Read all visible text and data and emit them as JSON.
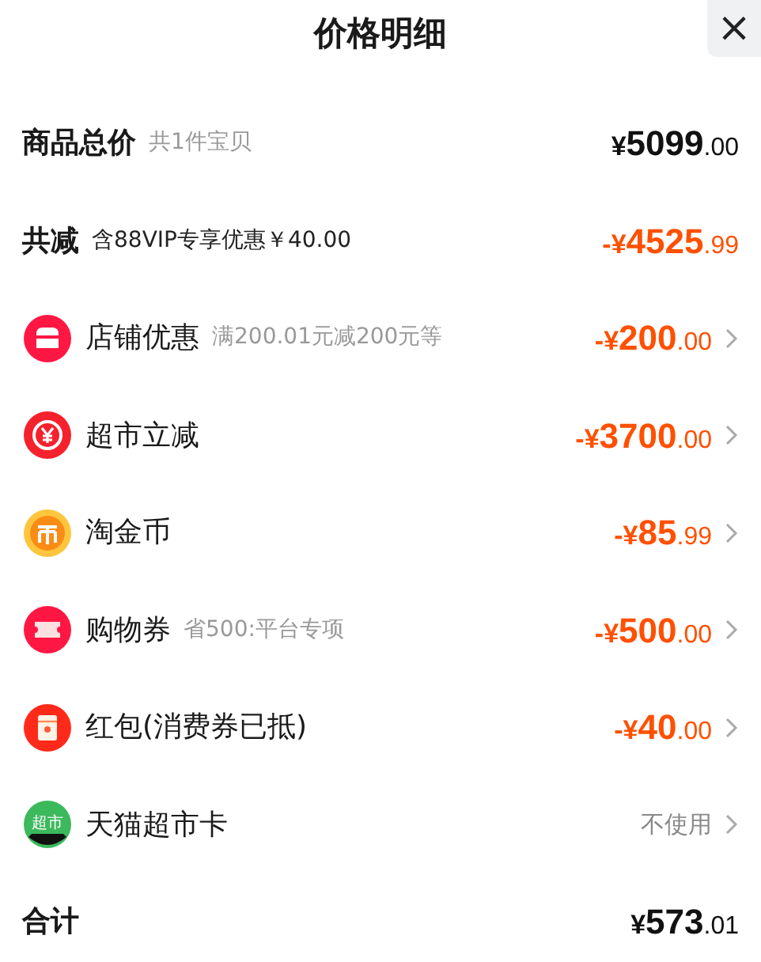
{
  "title": "价格明细",
  "close": "×",
  "rows": [
    {
      "kind": "summary",
      "label": "商品总价",
      "note": "共1件宝贝",
      "amount": {
        "prefix": "¥",
        "integer": "5099",
        "decimal": ".00",
        "negative": false
      },
      "arrow": false
    },
    {
      "kind": "reduction",
      "label": "共减",
      "note": "含88VIP专享优惠￥40.00",
      "amount": {
        "prefix": "-¥",
        "integer": "4525",
        "decimal": ".99",
        "negative": true
      },
      "arrow": false
    },
    {
      "kind": "item",
      "label": "店铺优惠",
      "note": "满200.01元减200元等",
      "amount": {
        "prefix": "-¥",
        "integer": "200",
        "decimal": ".00",
        "negative": true
      },
      "arrow": true
    },
    {
      "kind": "item",
      "label": "超市立减",
      "amount": {
        "prefix": "-¥",
        "integer": "3700",
        "decimal": ".00",
        "negative": true
      },
      "arrow": true
    },
    {
      "kind": "item",
      "label": "淘金币",
      "amount": {
        "prefix": "-¥",
        "integer": "85",
        "decimal": ".99",
        "negative": true
      },
      "arrow": true
    },
    {
      "kind": "item",
      "label": "购物券",
      "note": "省500:平台专项",
      "amount": {
        "prefix": "-¥",
        "integer": "500",
        "decimal": ".00",
        "negative": true
      },
      "arrow": true
    },
    {
      "kind": "item",
      "label": "红包(消费券已抵)",
      "amount": {
        "prefix": "-¥",
        "integer": "40",
        "decimal": ".00",
        "negative": true
      },
      "arrow": true
    },
    {
      "kind": "item",
      "icon_text": "超市",
      "label": "天猫超市卡",
      "value": "不使用",
      "arrow": true
    },
    {
      "kind": "summary",
      "label": "合计",
      "amount": {
        "prefix": "¥",
        "integer": "573",
        "decimal": ".01",
        "negative": false
      },
      "arrow": false
    }
  ]
}
